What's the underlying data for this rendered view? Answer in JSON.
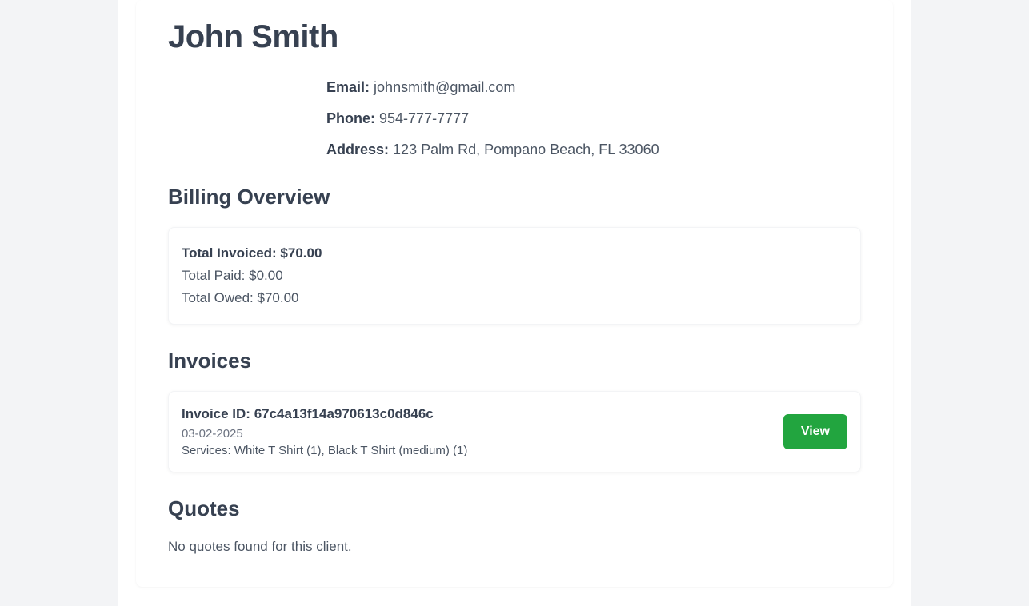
{
  "client": {
    "name": "John Smith",
    "email_label": "Email:",
    "email": "johnsmith@gmail.com",
    "phone_label": "Phone:",
    "phone": "954-777-7777",
    "address_label": "Address:",
    "address": "123 Palm Rd, Pompano Beach, FL 33060"
  },
  "billing": {
    "heading": "Billing Overview",
    "total_invoiced_label": "Total Invoiced: ",
    "total_invoiced": "$70.00",
    "total_paid_label": "Total Paid: ",
    "total_paid": "$0.00",
    "total_owed_label": "Total Owed: ",
    "total_owed": "$70.00"
  },
  "invoices": {
    "heading": "Invoices",
    "items": [
      {
        "id_label": "Invoice ID: ",
        "id": "67c4a13f14a970613c0d846c",
        "date": "03-02-2025",
        "services_label": "Services: ",
        "services": "White T Shirt (1), Black T Shirt (medium) (1)",
        "view_label": "View"
      }
    ]
  },
  "quotes": {
    "heading": "Quotes",
    "empty_message": "No quotes found for this client."
  }
}
